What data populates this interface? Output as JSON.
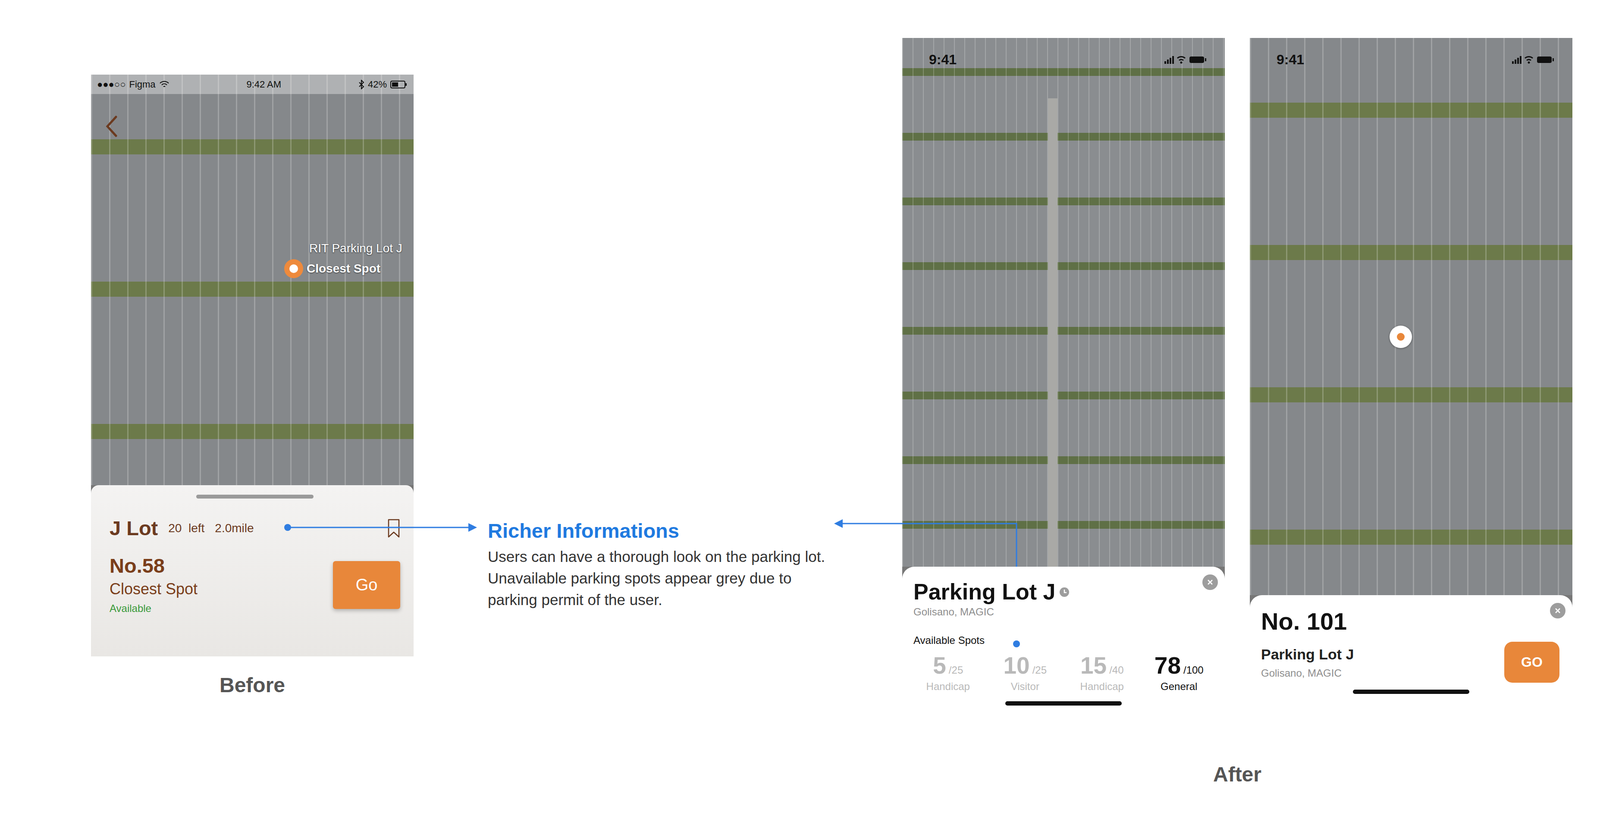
{
  "slide": {
    "before_label": "Before",
    "after_label": "After",
    "callout": {
      "title": "Richer Informations",
      "body": "Users can have a thorough look on the parking lot. Unavailable parking spots appear grey due to parking permit of the user."
    }
  },
  "before": {
    "status_bar": {
      "signal": "●●●○○",
      "carrier": "Figma",
      "time": "9:42 AM",
      "battery": "42%"
    },
    "map": {
      "place_label": "RIT Parking Lot J",
      "marker_label": "Closest Spot"
    },
    "sheet": {
      "lot": "J Lot",
      "spots_left": "20  left",
      "distance": "2.0mile",
      "spot": "No.58",
      "spot_kind": "Closest Spot",
      "availability": "Available",
      "button": "Go"
    }
  },
  "after_lot": {
    "status_bar": {
      "time": "9:41"
    },
    "sheet": {
      "title": "Parking Lot J",
      "subtitle": "Golisano, MAGIC",
      "section": "Available Spots",
      "stats": [
        {
          "count": "5",
          "total": "/25",
          "label": "Handicap",
          "selected": false
        },
        {
          "count": "10",
          "total": "/25",
          "label": "Visitor",
          "selected": false
        },
        {
          "count": "15",
          "total": "/40",
          "label": "Handicap",
          "selected": false
        },
        {
          "count": "78",
          "total": "/100",
          "label": "General",
          "selected": true
        }
      ]
    }
  },
  "after_spot": {
    "status_bar": {
      "time": "9:41"
    },
    "sheet": {
      "spot": "No. 101",
      "lot": "Parking Lot J",
      "subtitle": "Golisano, MAGIC",
      "button": "GO"
    }
  }
}
